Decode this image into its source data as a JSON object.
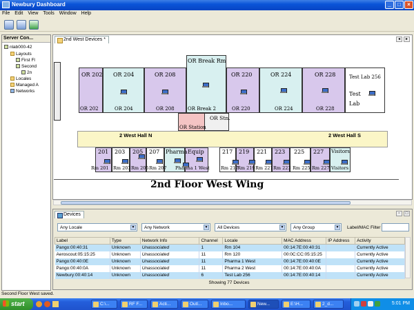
{
  "window": {
    "title": "Newbury Dashboard"
  },
  "menu": [
    "File",
    "Edit",
    "View",
    "Tools",
    "Window",
    "Help"
  ],
  "toolbar": {
    "icons": [
      "server-connect-icon",
      "database-icon",
      "refresh-icon"
    ]
  },
  "left_panel": {
    "title": "Server Con...",
    "tree": [
      {
        "label": "nlab000-42",
        "icon": "server-icon"
      },
      {
        "label": "Layouts",
        "icon": "folder-icon"
      },
      {
        "label": "First Fl",
        "icon": "layout-icon"
      },
      {
        "label": "Second",
        "icon": "layout-icon"
      },
      {
        "label": "2n",
        "icon": "layout-icon"
      },
      {
        "label": "Locales",
        "icon": "folder-icon"
      },
      {
        "label": "Managed A",
        "icon": "folder-icon"
      },
      {
        "label": "Networks",
        "icon": "network-icon"
      }
    ]
  },
  "map_tab": {
    "label": "2nd West Devices *"
  },
  "map": {
    "title": "2nd Floor West Wing",
    "rooms_top": [
      "OR 202",
      "OR 204",
      "OR 208",
      "OR Break Rm",
      "OR 220",
      "OR 224",
      "OR 228"
    ],
    "rooms_top_lower": [
      "OR 202",
      "OR 204",
      "OR 208",
      "OR Break 2",
      "OR 220",
      "OR 224",
      "OR 228"
    ],
    "lab": [
      "Test Lab 256",
      "Test",
      "Lab"
    ],
    "station": [
      "OR Station",
      "OR Stn."
    ],
    "halls": [
      "2 West Hall N",
      "2 West Hall S"
    ],
    "rooms_bottom": [
      "201",
      "203",
      "205",
      "207",
      "Pharma",
      "Equip",
      "217",
      "219",
      "221",
      "223",
      "225",
      "227",
      "Visitors"
    ],
    "rooms_bottom_lower": [
      "Rm 201",
      "Rm 203",
      "Rm 205",
      "Rm 207",
      "Pharma 1 West",
      "Rm 217",
      "Rm 219",
      "Rm 221",
      "Rm 223",
      "Rm 225",
      "Rm 227",
      "Visitors"
    ]
  },
  "devices": {
    "tab_label": "Devices",
    "filters": {
      "locale": "Any Locale",
      "network": "Any Network",
      "devices": "All Devices",
      "group": "Any Group"
    },
    "filter_label": "Label/MAC Filter",
    "columns": [
      "Label",
      "Type",
      "Network Info",
      "Channel",
      "Locale",
      "MAC Address",
      "IP Address",
      "Activity"
    ],
    "rows": [
      [
        "Pango:00:40:31",
        "Unknown",
        "Unassociated",
        "1",
        "Rm 104",
        "00:14:7E:00:40:31",
        "",
        "Currently Active"
      ],
      [
        "Aeroscout:05:15:25",
        "Unknown",
        "Unassociated",
        "11",
        "Rm 120",
        "00:0C:CC:05:15:25",
        "",
        "Currently Active"
      ],
      [
        "Pango:00:40:0E",
        "Unknown",
        "Unassociated",
        "11",
        "Pharma 1 West",
        "00:14:7E:00:40:0E",
        "",
        "Currently Active"
      ],
      [
        "Pango:00:40:0A",
        "Unknown",
        "Unassociated",
        "11",
        "Pharma 2 West",
        "00:14:7E:00:40:0A",
        "",
        "Currently Active"
      ],
      [
        "Newbury:00:40:14",
        "Unknown",
        "Unassociated",
        "6",
        "Test Lab 256",
        "00:14:7E:00:40:14",
        "",
        "Currently Active"
      ]
    ],
    "showing": "Showing 77 Devices"
  },
  "status": {
    "text": "Second Floor West saved."
  },
  "taskbar": {
    "start": "start",
    "tasks": [
      "C:\\...",
      "RF F...",
      "Acti...",
      "Outl...",
      "Inbo...",
      "New...",
      "E:\\H...",
      "2_d..."
    ],
    "clock": "5:01 PM"
  }
}
